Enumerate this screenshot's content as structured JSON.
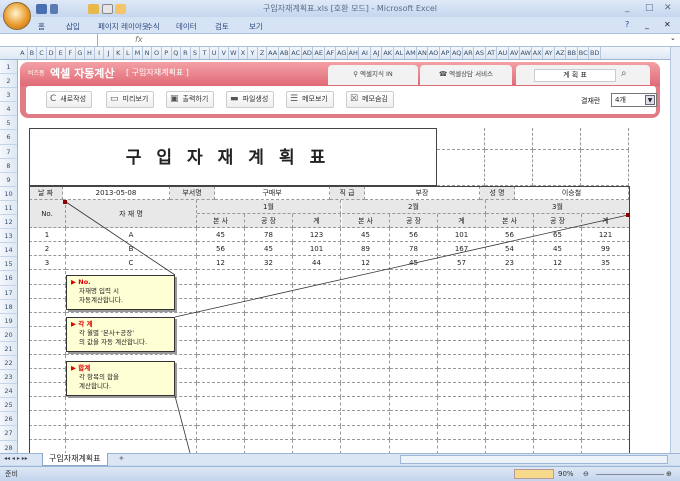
{
  "window": {
    "title": "구입자재계획표.xls  [호환 모드] - Microsoft Excel"
  },
  "ribbon_tabs": [
    "홈",
    "삽입",
    "페이지 레이아웃",
    "수식",
    "데이터",
    "검토",
    "보기"
  ],
  "formula_bar": {
    "fx": "fx"
  },
  "columns": [
    "A",
    "B",
    "C",
    "D",
    "E",
    "F",
    "G",
    "H",
    "I",
    "J",
    "K",
    "L",
    "M",
    "N",
    "O",
    "P",
    "Q",
    "R",
    "S",
    "T",
    "U",
    "V",
    "W",
    "X",
    "Y",
    "Z",
    "AA",
    "AB",
    "AC",
    "AD",
    "AE",
    "AF",
    "AG",
    "AH",
    "AI",
    "AJ",
    "AK",
    "AL",
    "AM",
    "AN",
    "AO",
    "AP",
    "AQ",
    "AR",
    "AS",
    "AT",
    "AU",
    "AV",
    "AW",
    "AX",
    "AY",
    "AZ",
    "BB",
    "BC",
    "BD"
  ],
  "banner": {
    "brand_small": "비즈폼",
    "brand": "엑셀 자동계산",
    "doc": "[ 구입자재계획표 ]",
    "tab1": "엑셀지식 IN",
    "tab2": "엑셀상담 서비스",
    "search_value": "계 획 표"
  },
  "toolbar": {
    "buttons": [
      "새로작성",
      "미리보기",
      "출력하기",
      "파일생성",
      "메모보기",
      "메모숨김"
    ],
    "approval_label": "결재란",
    "approval_value": "4개"
  },
  "form": {
    "title": "구입자재계획표",
    "info": {
      "date_label": "날 짜",
      "date": "2013-05-08",
      "dept_label": "부서명",
      "dept": "구매부",
      "rank_label": "직 급",
      "rank": "부장",
      "name_label": "성 명",
      "name": "이승철"
    },
    "headers": {
      "no": "No.",
      "item": "자   재   명",
      "months": [
        "1월",
        "2월",
        "3월"
      ],
      "sub": [
        "본  사",
        "공  장",
        "계"
      ]
    },
    "rows": [
      {
        "no": "1",
        "item": "A",
        "values": [
          45,
          78,
          123,
          45,
          56,
          101,
          56,
          65,
          121
        ]
      },
      {
        "no": "2",
        "item": "B",
        "values": [
          56,
          45,
          101,
          89,
          78,
          167,
          54,
          45,
          99
        ]
      },
      {
        "no": "3",
        "item": "C",
        "values": [
          12,
          32,
          44,
          12,
          45,
          57,
          23,
          12,
          35
        ]
      }
    ]
  },
  "notes": [
    {
      "title": "No.",
      "lines": [
        "자재명 입력 시",
        "자동계산합니다."
      ]
    },
    {
      "title": "각 계",
      "lines": [
        "각 월별 '본사+공장'",
        "의 값을 자동 계산합니다."
      ]
    },
    {
      "title": "합계",
      "lines": [
        "각 항목의 합을",
        "계산합니다."
      ]
    }
  ],
  "sheet_tab": "구입자재계획표",
  "status": {
    "ready": "준비",
    "zoom": "90%"
  }
}
